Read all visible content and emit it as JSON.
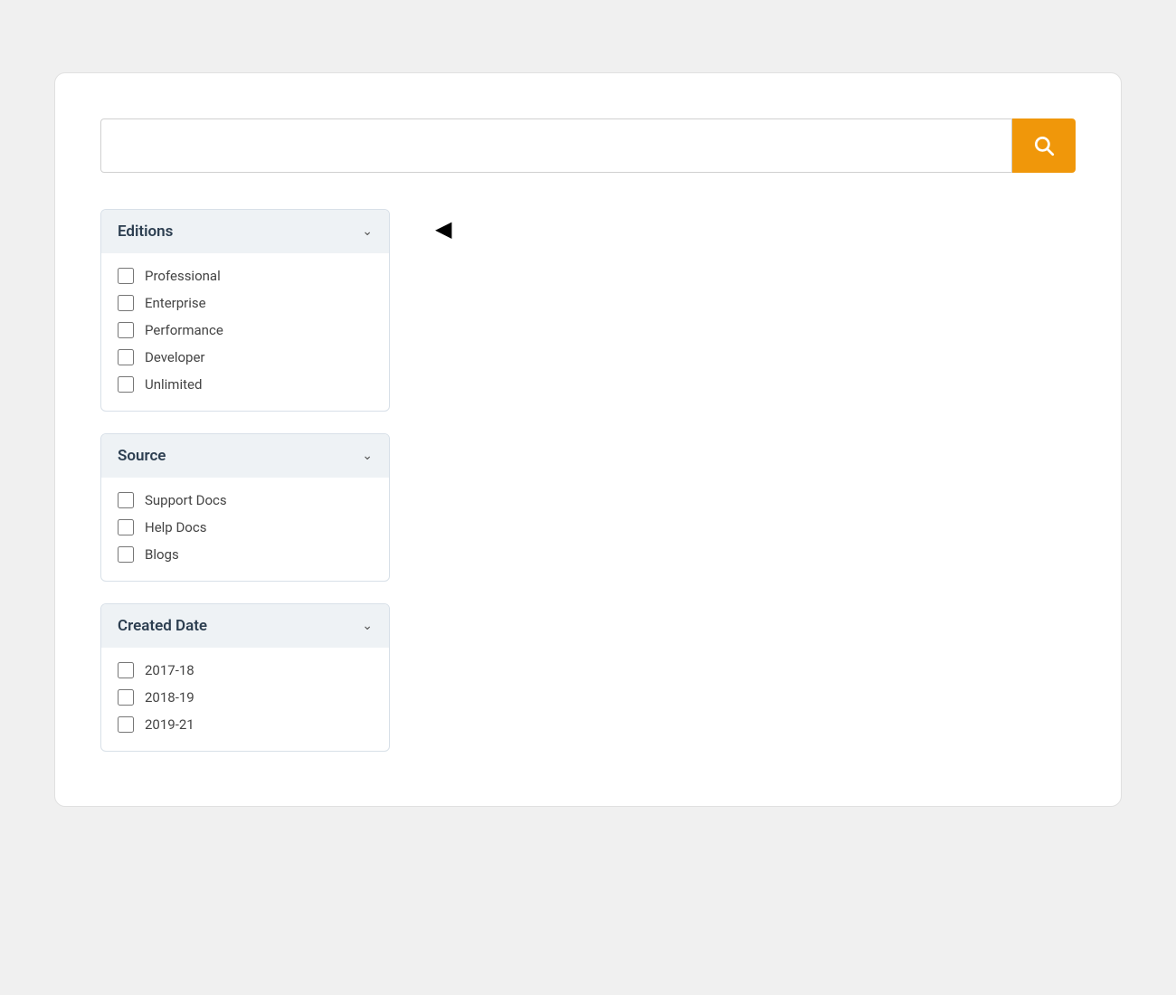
{
  "search": {
    "placeholder": "",
    "button_label": "Search"
  },
  "filters": {
    "editions": {
      "title": "Editions",
      "options": [
        {
          "label": "Professional",
          "checked": false
        },
        {
          "label": "Enterprise",
          "checked": false
        },
        {
          "label": "Performance",
          "checked": false
        },
        {
          "label": "Developer",
          "checked": false
        },
        {
          "label": "Unlimited",
          "checked": false
        }
      ]
    },
    "source": {
      "title": "Source",
      "options": [
        {
          "label": "Support Docs",
          "checked": false
        },
        {
          "label": "Help Docs",
          "checked": false
        },
        {
          "label": "Blogs",
          "checked": false
        }
      ]
    },
    "created_date": {
      "title": "Created Date",
      "options": [
        {
          "label": "2017-18",
          "checked": false
        },
        {
          "label": "2018-19",
          "checked": false
        },
        {
          "label": "2019-21",
          "checked": false
        }
      ]
    }
  }
}
